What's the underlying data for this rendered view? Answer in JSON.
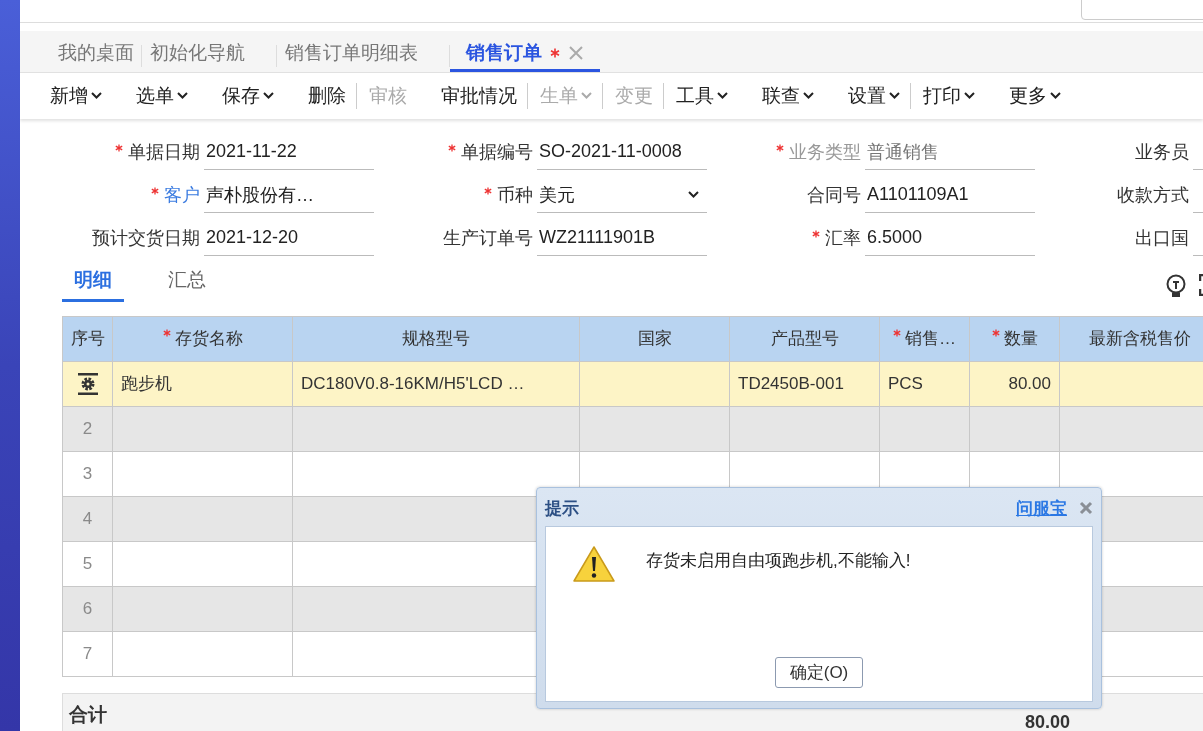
{
  "tabs": [
    {
      "label": "我的桌面",
      "selected": false,
      "modified": false
    },
    {
      "label": "初始化导航",
      "selected": false,
      "modified": false
    },
    {
      "label": "销售订单明细表",
      "selected": false,
      "modified": false
    },
    {
      "label": "销售订单",
      "selected": true,
      "modified": true
    }
  ],
  "toolbar": [
    {
      "label": "新增",
      "dropdown": true,
      "disabled": false,
      "separator_before": false
    },
    {
      "label": "选单",
      "dropdown": true,
      "disabled": false,
      "separator_before": false
    },
    {
      "label": "保存",
      "dropdown": true,
      "disabled": false,
      "separator_before": false
    },
    {
      "label": "删除",
      "dropdown": false,
      "disabled": false,
      "separator_before": false
    },
    {
      "label": "审核",
      "dropdown": false,
      "disabled": true,
      "separator_before": true
    },
    {
      "label": "审批情况",
      "dropdown": false,
      "disabled": false,
      "separator_before": false
    },
    {
      "label": "生单",
      "dropdown": true,
      "disabled": true,
      "separator_before": true
    },
    {
      "label": "变更",
      "dropdown": false,
      "disabled": true,
      "separator_before": true
    },
    {
      "label": "工具",
      "dropdown": true,
      "disabled": false,
      "separator_before": true
    },
    {
      "label": "联查",
      "dropdown": true,
      "disabled": false,
      "separator_before": false
    },
    {
      "label": "设置",
      "dropdown": true,
      "disabled": false,
      "separator_before": false
    },
    {
      "label": "打印",
      "dropdown": true,
      "disabled": false,
      "separator_before": true
    },
    {
      "label": "更多",
      "dropdown": true,
      "disabled": false,
      "separator_before": false
    }
  ],
  "form": [
    {
      "label": "单据日期",
      "value": "2021-11-22",
      "required": true,
      "kind": "text"
    },
    {
      "label": "单据编号",
      "value": "SO-2021-11-0008",
      "required": true,
      "kind": "text"
    },
    {
      "label": "业务类型",
      "value": "普通销售",
      "required": true,
      "kind": "disabled"
    },
    {
      "label": "业务员",
      "required": false,
      "kind": "text"
    },
    {
      "label": "客户",
      "value": "声朴股份有…",
      "required": true,
      "kind": "link"
    },
    {
      "label": "币种",
      "value": "美元",
      "required": true,
      "kind": "select"
    },
    {
      "label": "合同号",
      "value": "A1101109A1",
      "required": false,
      "kind": "text"
    },
    {
      "label": "收款方式",
      "required": false,
      "kind": "text"
    },
    {
      "label": "预计交货日期",
      "value": "2021-12-20",
      "required": false,
      "kind": "text"
    },
    {
      "label": "生产订单号",
      "value": "WZ21111901B",
      "required": false,
      "kind": "text"
    },
    {
      "label": "汇率",
      "value": "6.5000",
      "required": true,
      "kind": "text"
    },
    {
      "label": "出口国",
      "required": false,
      "kind": "text"
    }
  ],
  "detail_tabs": [
    {
      "label": "明细",
      "selected": true
    },
    {
      "label": "汇总",
      "selected": false
    }
  ],
  "table": {
    "columns": [
      {
        "label": "序号",
        "required": false
      },
      {
        "label": "存货名称",
        "required": true
      },
      {
        "label": "规格型号",
        "required": false
      },
      {
        "label": "国家",
        "required": false
      },
      {
        "label": "产品型号",
        "required": false
      },
      {
        "label": "销售…",
        "required": true
      },
      {
        "label": "数量",
        "required": true
      },
      {
        "label": "最新含税售价",
        "required": false
      }
    ],
    "rows": [
      {
        "selected": true,
        "cells": [
          "",
          "跑步机",
          "DC180V0.8-16KM/H5'LCD …",
          "",
          "TD2450B-001",
          "PCS",
          "80.00",
          ""
        ]
      },
      {
        "selected": false,
        "cells": [
          "2",
          "",
          "",
          "",
          "",
          "",
          "",
          ""
        ]
      },
      {
        "selected": false,
        "cells": [
          "3",
          "",
          "",
          "",
          "",
          "",
          "",
          ""
        ]
      },
      {
        "selected": false,
        "cells": [
          "4",
          "",
          "",
          "",
          "",
          "",
          "",
          ""
        ]
      },
      {
        "selected": false,
        "cells": [
          "5",
          "",
          "",
          "",
          "",
          "",
          "",
          ""
        ]
      },
      {
        "selected": false,
        "cells": [
          "6",
          "",
          "",
          "",
          "",
          "",
          "",
          ""
        ]
      },
      {
        "selected": false,
        "cells": [
          "7",
          "",
          "",
          "",
          "",
          "",
          "",
          ""
        ]
      }
    ],
    "total": {
      "label": "合计",
      "quantity": "80.00"
    }
  },
  "dialog": {
    "title": "提示",
    "help_link": "问服宝",
    "message": "存货未启用自由项跑步机,不能输入!",
    "button": "确定(O)"
  }
}
